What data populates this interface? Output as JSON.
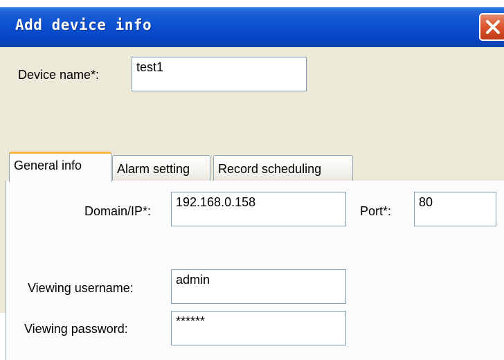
{
  "dialog": {
    "title": "Add device info",
    "close_icon": "close-icon"
  },
  "device_name": {
    "label": "Device name*:",
    "value": "test1"
  },
  "tabs": [
    {
      "label": "General info",
      "active": true
    },
    {
      "label": "Alarm setting",
      "active": false
    },
    {
      "label": "Record scheduling",
      "active": false
    }
  ],
  "general": {
    "domain_label": "Domain/IP*:",
    "domain_value": "192.168.0.158",
    "port_label": "Port*:",
    "port_value": "80",
    "username_label": "Viewing username:",
    "username_value": "admin",
    "password_label": "Viewing password:",
    "password_value": "******"
  },
  "colors": {
    "titlebar": "#0a50d2",
    "close_button": "#d9532c",
    "dialog_bg": "#ece9d8",
    "active_tab_highlight": "#f4b43a"
  }
}
